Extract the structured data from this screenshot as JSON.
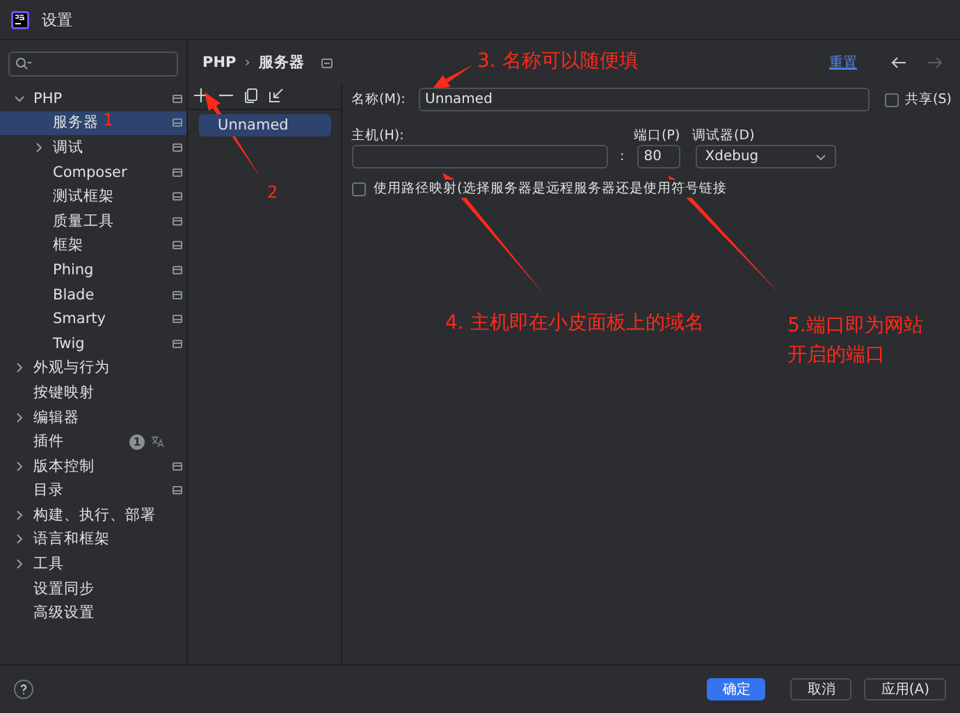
{
  "window": {
    "title": "设置"
  },
  "tree": [
    {
      "label": "PHP",
      "expanded": true,
      "selected": false,
      "project_scope": true,
      "children": [
        {
          "label": "服务器",
          "selected": true,
          "project_scope": true
        },
        {
          "label": "调试",
          "expanded": false,
          "selected": false,
          "project_scope": true
        },
        {
          "label": "Composer",
          "selected": false,
          "project_scope": true
        },
        {
          "label": "测试框架",
          "selected": false,
          "project_scope": true
        },
        {
          "label": "质量工具",
          "selected": false,
          "project_scope": true
        },
        {
          "label": "框架",
          "selected": false,
          "project_scope": true
        },
        {
          "label": "Phing",
          "selected": false,
          "project_scope": true
        },
        {
          "label": "Blade",
          "selected": false,
          "project_scope": true
        },
        {
          "label": "Smarty",
          "selected": false,
          "project_scope": true
        },
        {
          "label": "Twig",
          "selected": false,
          "project_scope": true
        }
      ]
    },
    {
      "label": "外观与行为",
      "expanded": false,
      "selected": false,
      "project_scope": false
    },
    {
      "label": "按键映射",
      "selected": false,
      "project_scope": false
    },
    {
      "label": "编辑器",
      "expanded": false,
      "selected": false,
      "project_scope": false
    },
    {
      "label": "插件",
      "selected": false,
      "project_scope": false,
      "badge": "1"
    },
    {
      "label": "版本控制",
      "expanded": false,
      "selected": false,
      "project_scope": true
    },
    {
      "label": "目录",
      "selected": false,
      "project_scope": true
    },
    {
      "label": "构建、执行、部署",
      "expanded": false,
      "selected": false,
      "project_scope": false
    },
    {
      "label": "语言和框架",
      "expanded": false,
      "selected": false,
      "project_scope": false
    },
    {
      "label": "工具",
      "expanded": false,
      "selected": false,
      "project_scope": false
    },
    {
      "label": "设置同步",
      "selected": false,
      "project_scope": false
    },
    {
      "label": "高级设置",
      "selected": false,
      "project_scope": false
    }
  ],
  "breadcrumb": {
    "parent": "PHP",
    "separator": "›",
    "current": "服务器"
  },
  "reset_link": "重置",
  "nav": {
    "back_disabled": false,
    "forward_disabled": true
  },
  "servers": [
    {
      "name": "Unnamed",
      "selected": true
    }
  ],
  "form": {
    "name_label": "名称(M):",
    "name_value": "Unnamed",
    "share_label": "共享(S)",
    "share_checked": false,
    "host_label": "主机(H):",
    "colon": ":",
    "port_label": "端口(P)",
    "port_value": "80",
    "debugger_label": "调试器(D)",
    "debugger_value": "Xdebug",
    "path_mapping_label": "使用路径映射(选择服务器是远程服务器还是使用符号链接",
    "path_mapping_checked": false
  },
  "annotations": [
    {
      "text": "1"
    },
    {
      "text": "2"
    },
    {
      "text": "3. 名称可以随便填"
    },
    {
      "text": "4. 主机即在小皮面板上的域名"
    },
    {
      "text": "5.端口即为网站开启的端口"
    }
  ],
  "buttons": [
    {
      "label": "确定",
      "kind": "primary"
    },
    {
      "label": "取消",
      "kind": "secondary"
    },
    {
      "label": "应用(A)",
      "kind": "secondary"
    }
  ]
}
